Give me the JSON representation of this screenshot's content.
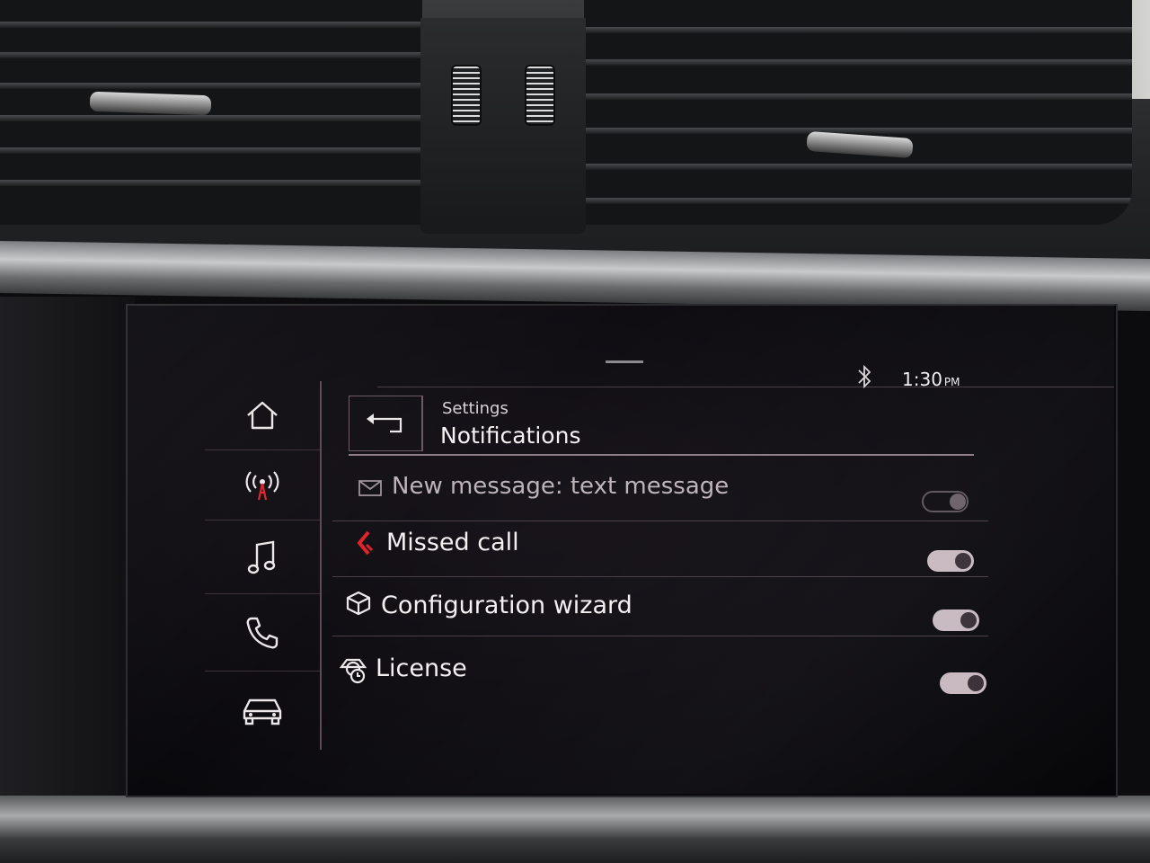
{
  "status": {
    "time": "1:30",
    "ampm": "PM",
    "bluetooth_icon": "bluetooth-icon"
  },
  "sidebar": {
    "items": [
      {
        "name": "home",
        "icon": "home-icon"
      },
      {
        "name": "radio",
        "icon": "radio-antenna-icon"
      },
      {
        "name": "media",
        "icon": "music-note-icon"
      },
      {
        "name": "phone",
        "icon": "phone-icon"
      },
      {
        "name": "car",
        "icon": "car-icon"
      }
    ]
  },
  "header": {
    "breadcrumb": "Settings",
    "title": "Notifications",
    "back_icon": "back-arrow-icon"
  },
  "notifications": [
    {
      "label": "New message: text message",
      "icon": "envelope-icon",
      "enabled": false
    },
    {
      "label": "Missed call",
      "icon": "missed-call-icon",
      "enabled": true
    },
    {
      "label": "Configuration wizard",
      "icon": "cube-icon",
      "enabled": true
    },
    {
      "label": "License",
      "icon": "license-icon",
      "enabled": true
    }
  ],
  "colors": {
    "accent_red": "#e0242c",
    "text": "#f4f0f2",
    "toggle_on": "#c8b9c1"
  }
}
